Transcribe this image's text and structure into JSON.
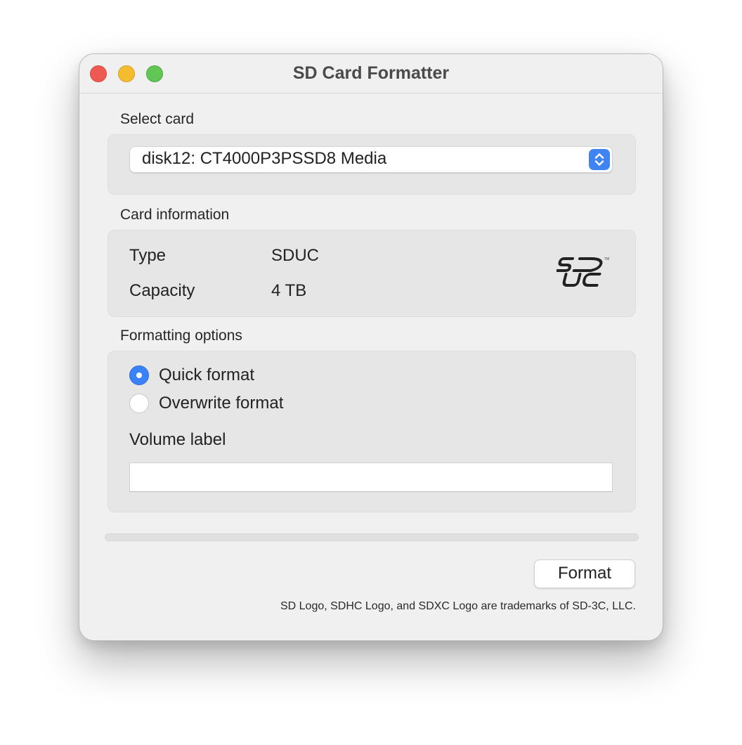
{
  "window": {
    "title": "SD Card Formatter"
  },
  "select_card": {
    "label": "Select card",
    "selected": "disk12: CT4000P3PSSD8 Media"
  },
  "card_information": {
    "label": "Card information",
    "type_label": "Type",
    "type_value": "SDUC",
    "capacity_label": "Capacity",
    "capacity_value": "4 TB",
    "logo_text": "SDUC"
  },
  "formatting_options": {
    "label": "Formatting options",
    "options": [
      {
        "label": "Quick format",
        "selected": true
      },
      {
        "label": "Overwrite format",
        "selected": false
      }
    ],
    "volume_label": "Volume label",
    "volume_value": ""
  },
  "progress": 0,
  "format_button": "Format",
  "footnote": "SD Logo, SDHC Logo, and SDXC Logo are trademarks of SD-3C, LLC.",
  "colors": {
    "accent": "#3a82f7",
    "close": "#ee5a52",
    "minimize": "#f4bc2f",
    "maximize": "#62c655"
  }
}
